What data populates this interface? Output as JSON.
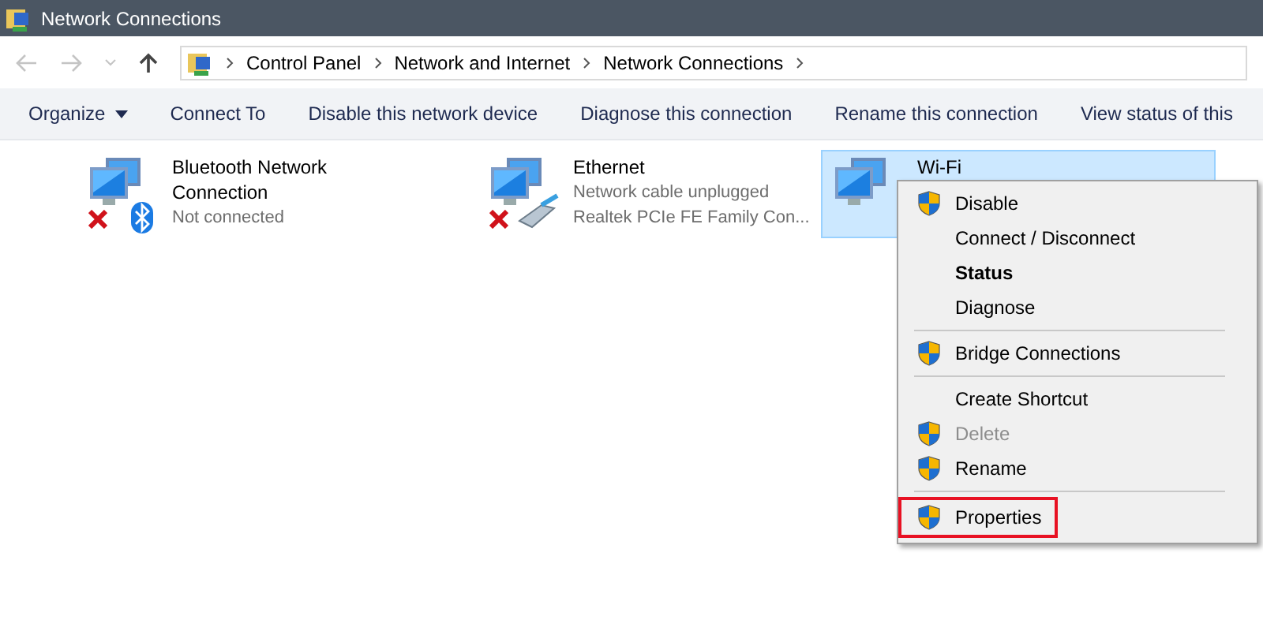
{
  "window": {
    "title": "Network Connections"
  },
  "nav": {
    "breadcrumbs": [
      "Control Panel",
      "Network and Internet",
      "Network Connections"
    ]
  },
  "toolbar": [
    {
      "label": "Organize",
      "dropdown": true
    },
    {
      "label": "Connect To",
      "dropdown": false
    },
    {
      "label": "Disable this network device",
      "dropdown": false
    },
    {
      "label": "Diagnose this connection",
      "dropdown": false
    },
    {
      "label": "Rename this connection",
      "dropdown": false
    },
    {
      "label": "View status of this",
      "dropdown": false
    }
  ],
  "connections": [
    {
      "name": "Bluetooth Network Connection",
      "lines": [
        "Not connected"
      ],
      "kind": "bluetooth",
      "selected": false,
      "error": true
    },
    {
      "name": "Ethernet",
      "lines": [
        "Network cable unplugged",
        "Realtek PCIe FE Family Con..."
      ],
      "kind": "ethernet",
      "selected": false,
      "error": true
    },
    {
      "name": "Wi-Fi",
      "kind": "wifi",
      "selected": true,
      "error": false
    }
  ],
  "context_menu": [
    {
      "kind": "item",
      "label": "Disable",
      "shield": true,
      "bold": false,
      "disabled": false,
      "highlighted": false
    },
    {
      "kind": "item",
      "label": "Connect / Disconnect",
      "shield": false,
      "bold": false,
      "disabled": false,
      "highlighted": false
    },
    {
      "kind": "item",
      "label": "Status",
      "shield": false,
      "bold": true,
      "disabled": false,
      "highlighted": false
    },
    {
      "kind": "item",
      "label": "Diagnose",
      "shield": false,
      "bold": false,
      "disabled": false,
      "highlighted": false
    },
    {
      "kind": "separator"
    },
    {
      "kind": "item",
      "label": "Bridge Connections",
      "shield": true,
      "bold": false,
      "disabled": false,
      "highlighted": false
    },
    {
      "kind": "separator"
    },
    {
      "kind": "item",
      "label": "Create Shortcut",
      "shield": false,
      "bold": false,
      "disabled": false,
      "highlighted": false
    },
    {
      "kind": "item",
      "label": "Delete",
      "shield": true,
      "bold": false,
      "disabled": true,
      "highlighted": false
    },
    {
      "kind": "item",
      "label": "Rename",
      "shield": true,
      "bold": false,
      "disabled": false,
      "highlighted": false
    },
    {
      "kind": "separator"
    },
    {
      "kind": "item",
      "label": "Properties",
      "shield": true,
      "bold": false,
      "disabled": false,
      "highlighted": true
    }
  ]
}
